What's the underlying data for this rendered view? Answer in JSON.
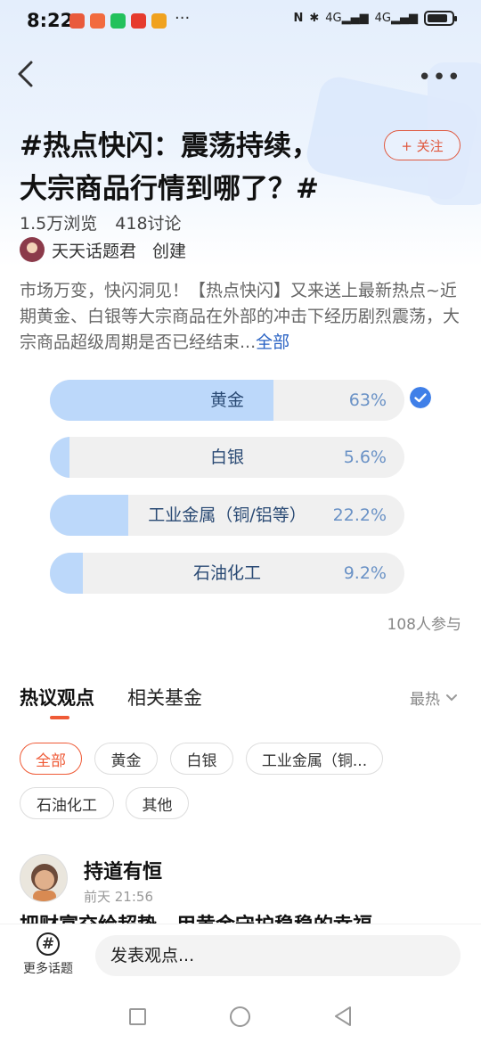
{
  "status_bar": {
    "time": "8:22",
    "dots": "···",
    "signal_1": "4G",
    "signal_2": "4G",
    "app_icons": [
      "#e95a3c",
      "#f26b3f",
      "#23c15c",
      "#e63b2e",
      "#f0a21f"
    ]
  },
  "nav": {
    "back_icon": "chevron-left-icon",
    "more_icon": "more-horizontal-icon"
  },
  "topic": {
    "title_line1": "#热点快闪：震荡持续，",
    "title_line2": "大宗商品行情到哪了？#",
    "follow_label": "+ 关注",
    "views": "1.5万浏览",
    "discussions": "418讨论",
    "creator_name": "天天话题君",
    "creator_action": "创建",
    "description": "市场万变，快闪洞见！【热点快闪】又来送上最新热点~近期黄金、白银等大宗商品在外部的冲击下经历剧烈震荡，大宗商品超级周期是否已经结束...",
    "description_more": "全部"
  },
  "poll": {
    "options": [
      {
        "label": "黄金",
        "percent_text": "63%",
        "percent": 63,
        "selected": true
      },
      {
        "label": "白银",
        "percent_text": "5.6%",
        "percent": 5.6,
        "selected": false
      },
      {
        "label": "工业金属（铜/铝等）",
        "percent_text": "22.2%",
        "percent": 22.2,
        "selected": false
      },
      {
        "label": "石油化工",
        "percent_text": "9.2%",
        "percent": 9.2,
        "selected": false
      }
    ],
    "participants": "108人参与"
  },
  "tabs": {
    "active": "热议观点",
    "second": "相关基金",
    "sort_label": "最热"
  },
  "filters": [
    "全部",
    "黄金",
    "白银",
    "工业金属（铜...",
    "石油化工",
    "其他"
  ],
  "comment": {
    "author": "持道有恒",
    "time": "前天 21:56",
    "text_partial": "把财富交给超势，用黄金守护稳稳的幸福"
  },
  "bottom": {
    "more_topics": "更多话题",
    "input_placeholder": "发表观点..."
  },
  "colors": {
    "accent": "#ef5a36",
    "poll_fill": "#bcd8fa",
    "poll_text": "#2a4a74",
    "link": "#2a63c4"
  }
}
